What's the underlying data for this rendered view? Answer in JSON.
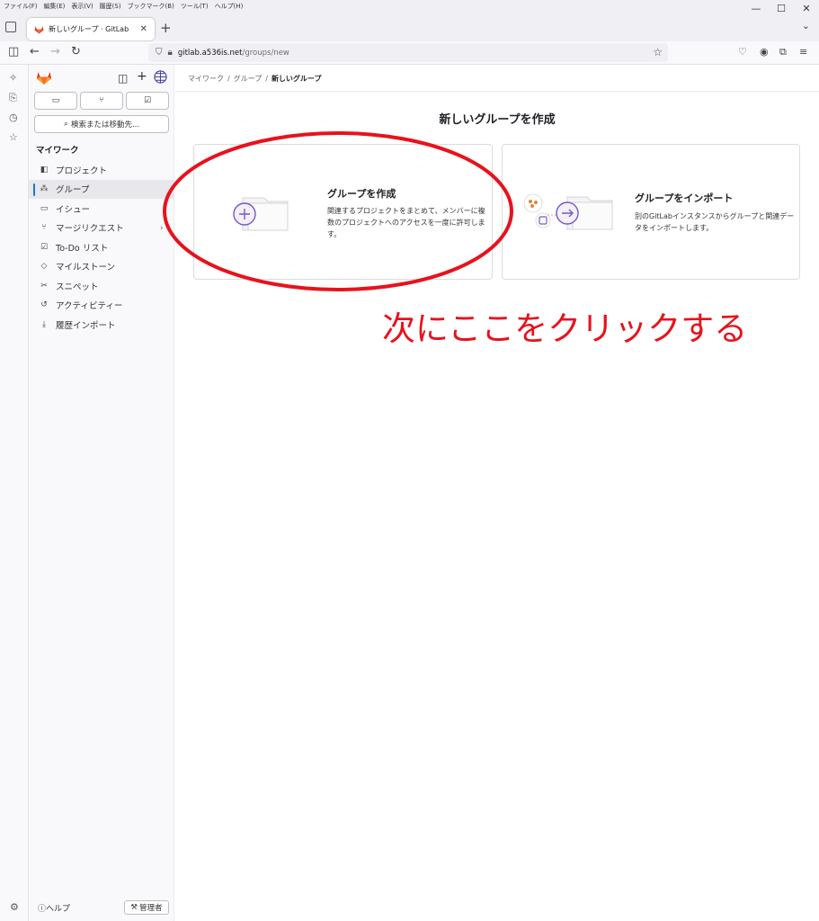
{
  "browser": {
    "menu": [
      "ファイル(F)",
      "編集(E)",
      "表示(V)",
      "履歴(S)",
      "ブックマーク(B)",
      "ツール(T)",
      "ヘルプ(H)"
    ],
    "tab_title": "新しいグループ · GitLab",
    "url_host": "gitlab.a536is.net",
    "url_path": "/groups/new"
  },
  "sidebar": {
    "search_label": "検索または移動先...",
    "section_title": "マイワーク",
    "items": [
      {
        "label": "プロジェクト",
        "icon": "project-icon"
      },
      {
        "label": "グループ",
        "icon": "group-icon",
        "active": true
      },
      {
        "label": "イシュー",
        "icon": "issue-icon"
      },
      {
        "label": "マージリクエスト",
        "icon": "merge-request-icon"
      },
      {
        "label": "To-Do リスト",
        "icon": "todo-icon"
      },
      {
        "label": "マイルストーン",
        "icon": "milestone-icon"
      },
      {
        "label": "スニペット",
        "icon": "snippet-icon"
      },
      {
        "label": "アクティビティー",
        "icon": "activity-icon"
      },
      {
        "label": "履歴インポート",
        "icon": "import-icon"
      }
    ],
    "help_label": "ヘルプ",
    "admin_label": "管理者"
  },
  "breadcrumb": [
    "マイワーク",
    "グループ",
    "新しいグループ"
  ],
  "page_title": "新しいグループを作成",
  "cards": {
    "create": {
      "title": "グループを作成",
      "description": "関連するプロジェクトをまとめて、メンバーに複数のプロジェクトへのアクセスを一度に許可します。"
    },
    "import": {
      "title": "グループをインポート",
      "description": "別のGitLabインスタンスからグループと関連データをインポートします。"
    }
  },
  "annotation": {
    "text": "次にここをクリックする",
    "color": "#e8121c"
  },
  "colors": {
    "accent": "#7759c2",
    "active_indicator": "#1f75cb"
  }
}
